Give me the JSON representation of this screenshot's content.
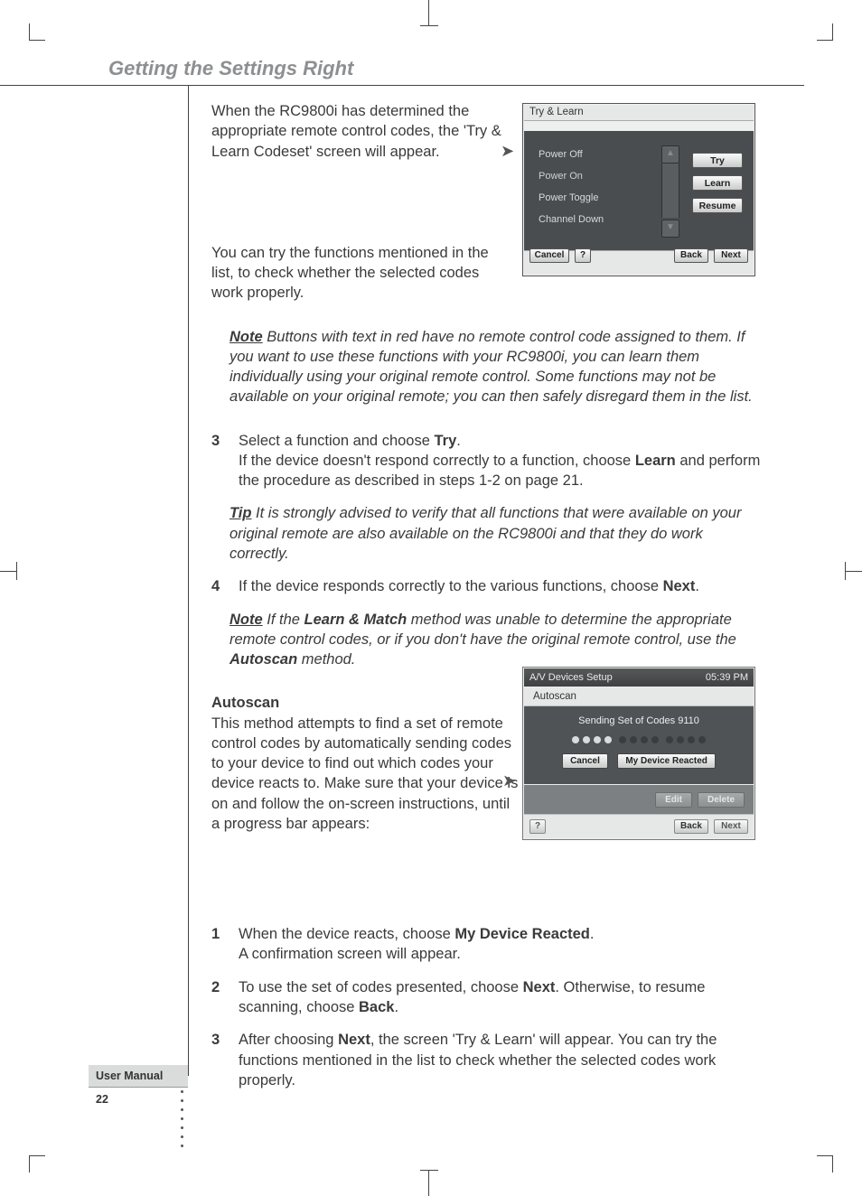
{
  "header": {
    "section_title": "Getting the Settings Right"
  },
  "body": {
    "p1": "When the RC9800i has determined the appropriate remote control codes, the 'Try & Learn Codeset' screen will appear.",
    "p2": "You can try the functions mentioned in the list, to check whether the selected codes work properly.",
    "note1_label": "Note",
    "note1": " Buttons with text in red have no remote control code assigned to them. If you want to use these functions with your RC9800i, you can learn them individually using your original remote control. Some functions may not be available on your original remote; you can then safely disregard them in the list.",
    "step3_num": "3",
    "step3_a": "Select a function and choose ",
    "step3_b": "Try",
    "step3_c": ".",
    "step3_d": "If the device doesn't respond correctly to a function, choose ",
    "step3_e": "Learn",
    "step3_f": " and perform the procedure as described in steps 1-2 on page 21.",
    "tip1_label": "Tip",
    "tip1": " It is strongly advised to verify that all functions that were available on your original remote are also available on the RC9800i and that they do work correctly.",
    "step4_num": "4",
    "step4_a": "If the device responds correctly to the various functions, choose ",
    "step4_b": "Next",
    "step4_c": ".",
    "note2_label": "Note",
    "note2_a": " If the ",
    "note2_b": "Learn & Match",
    "note2_c": " method was unable to determine the appropriate remote control codes, or if you don't have the original remote control, use the ",
    "note2_d": "Autoscan",
    "note2_e": " method.",
    "h_autoscan": "Autoscan",
    "p_autoscan": "This method attempts to find a set of remote control codes by automatically sending codes to your device to find out which codes your device reacts to. Make sure that your device is on and follow the on-screen instructions, until a progress bar appears:",
    "as1_num": "1",
    "as1_a": "When the device reacts, choose ",
    "as1_b": "My Device Reacted",
    "as1_c": ".",
    "as1_d": "A confirmation screen will appear.",
    "as2_num": "2",
    "as2_a": "To use the set of codes presented, choose ",
    "as2_b": "Next",
    "as2_c": ". Otherwise, to resume scanning, choose ",
    "as2_d": "Back",
    "as2_e": ".",
    "as3_num": "3",
    "as3_a": "After choosing ",
    "as3_b": "Next",
    "as3_c": ", the screen 'Try & Learn' will appear. You can try the functions mentioned in the list to check whether the selected codes work properly."
  },
  "shot1": {
    "title": "Try & Learn",
    "items": [
      "Power Off",
      "Power On",
      "Power Toggle",
      "Channel Down"
    ],
    "btn_try": "Try",
    "btn_learn": "Learn",
    "btn_resume": "Resume",
    "btn_cancel": "Cancel",
    "btn_help": "?",
    "btn_back": "Back",
    "btn_next": "Next"
  },
  "shot2": {
    "top_title": "A/V Devices Setup",
    "clock": "05:39 PM",
    "section": "Autoscan",
    "sending": "Sending Set of Codes 9110",
    "btn_cancel": "Cancel",
    "btn_reacted": "My Device Reacted",
    "btn_edit": "Edit",
    "btn_delete": "Delete",
    "btn_help": "?",
    "btn_back": "Back",
    "btn_next": "Next"
  },
  "footer": {
    "label": "User Manual",
    "page": "22"
  }
}
